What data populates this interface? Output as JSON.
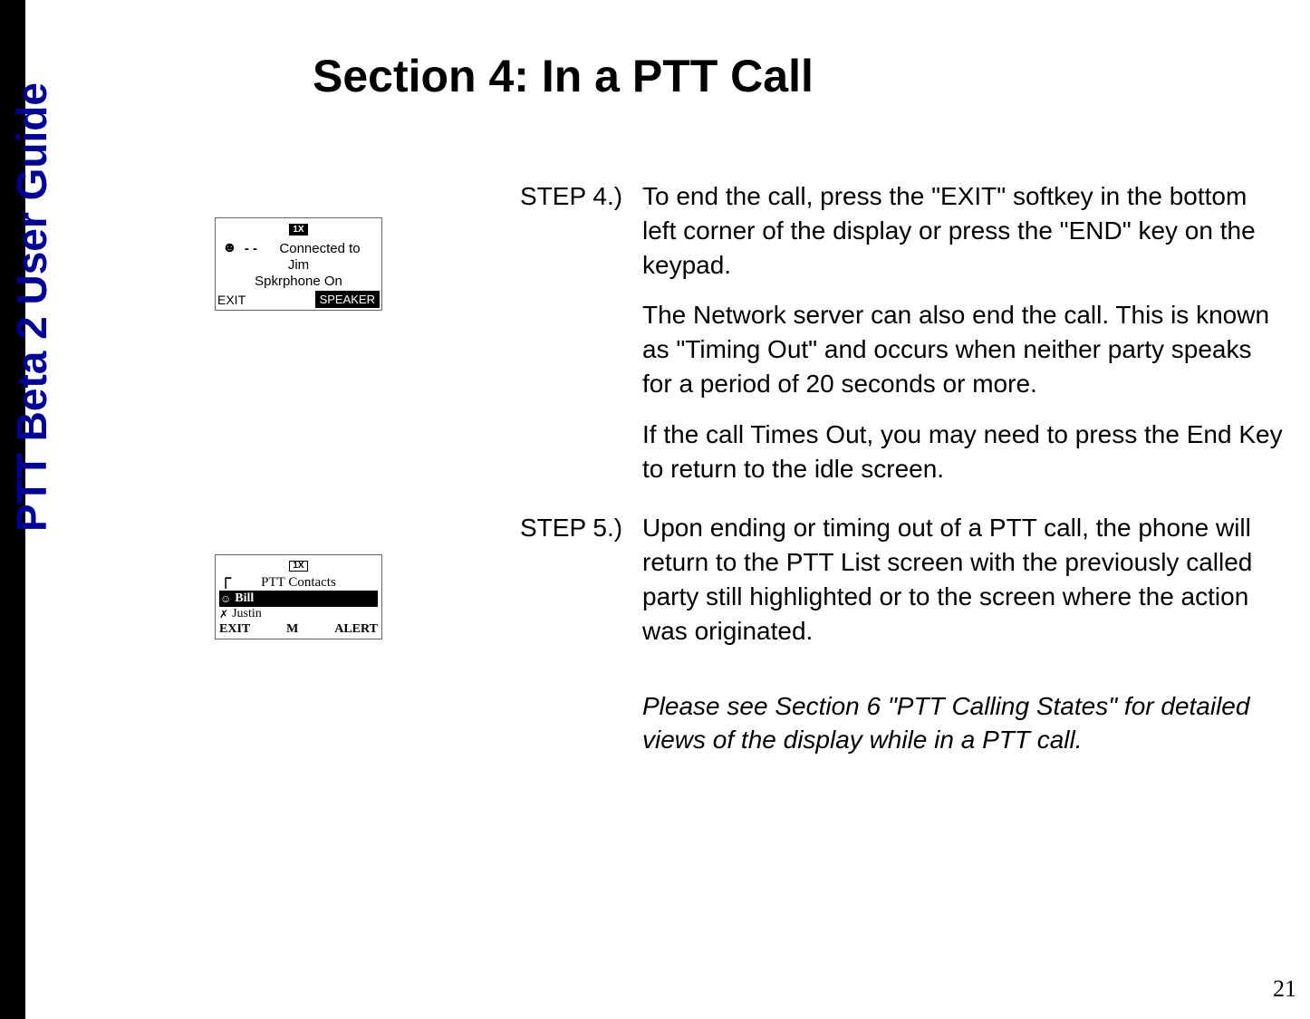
{
  "sidebar": {
    "title": "PTT Beta 2 User Guide"
  },
  "page": {
    "title": "Section 4: In a PTT Call",
    "number": "21"
  },
  "screen1": {
    "icon": "1X",
    "connected": "Connected to",
    "name": "Jim",
    "speaker_status": "Spkrphone On",
    "softkey_left": "EXIT",
    "softkey_right": "SPEAKER"
  },
  "screen2": {
    "icon": "1X",
    "header": "PTT Contacts",
    "contact_selected": "Bill",
    "contact_other": "Justin",
    "softkey_left": "EXIT",
    "softkey_center": "M",
    "softkey_right": "ALERT"
  },
  "steps": {
    "step4_label": "STEP 4.)",
    "step4_text": "To end the call, press the \"EXIT\" softkey in the bottom left corner of the display or press the \"END\" key on the keypad.",
    "step4_sub1": "The Network server can also end the call.  This is known as \"Timing Out\" and occurs when neither party speaks for  a period of 20 seconds or more.",
    "step4_sub2": "If the call Times Out, you may need to press the End Key to return to the idle screen.",
    "step5_label": "STEP 5.)",
    "step5_text": "Upon ending or timing out of a PTT call, the phone will return to the PTT List screen with the previously called party still highlighted or to the screen where the action was originated.",
    "step5_note": "Please see Section 6 \"PTT Calling States\" for detailed views of the display while in a PTT call."
  }
}
